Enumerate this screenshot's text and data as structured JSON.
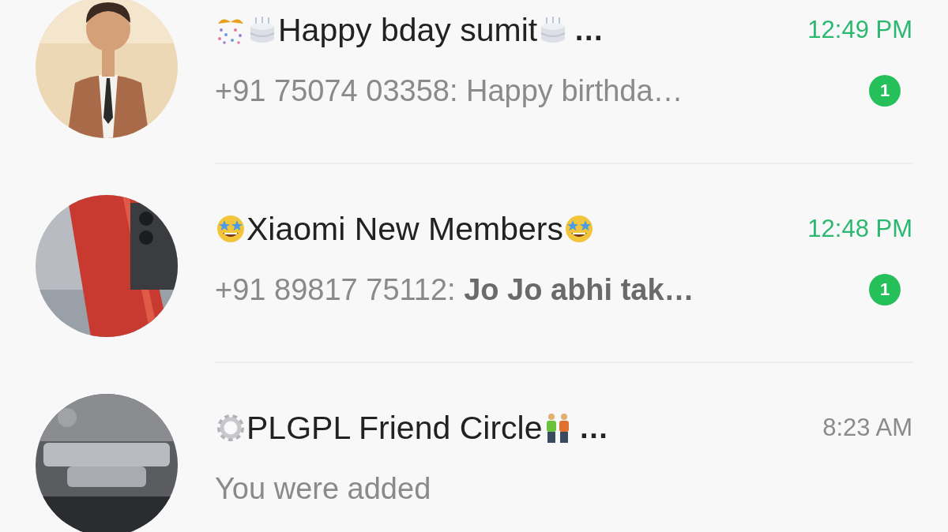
{
  "chats": [
    {
      "avatar": {
        "kind": "picture"
      },
      "emoji_before": [
        {
          "kind": "confetti"
        },
        {
          "kind": "cake"
        }
      ],
      "name": "Happy bday sumit",
      "emoji_after": [
        {
          "kind": "cake"
        }
      ],
      "name_ellipsis": "…",
      "time": "12:49 PM",
      "unread": true,
      "preview": "+91 75074 03358: Happy birthda…",
      "unread_count": "1"
    },
    {
      "avatar": {
        "kind": "picture"
      },
      "emoji_before": [
        {
          "kind": "starstruck"
        }
      ],
      "name": "Xiaomi New Members",
      "emoji_after": [
        {
          "kind": "starstruck"
        }
      ],
      "time": "12:48 PM",
      "unread": true,
      "preview": "+91 89817 75112: **Jo Jo abhi tak…**",
      "unread_count": "1"
    },
    {
      "avatar": {
        "kind": "picture"
      },
      "emoji_before": [
        {
          "kind": "gear"
        }
      ],
      "name": "PLGPL Friend Circle",
      "emoji_after": [
        {
          "kind": "two-men"
        }
      ],
      "name_ellipsis": "…",
      "time": "8:23 AM",
      "unread": false,
      "preview": "You were added"
    }
  ]
}
